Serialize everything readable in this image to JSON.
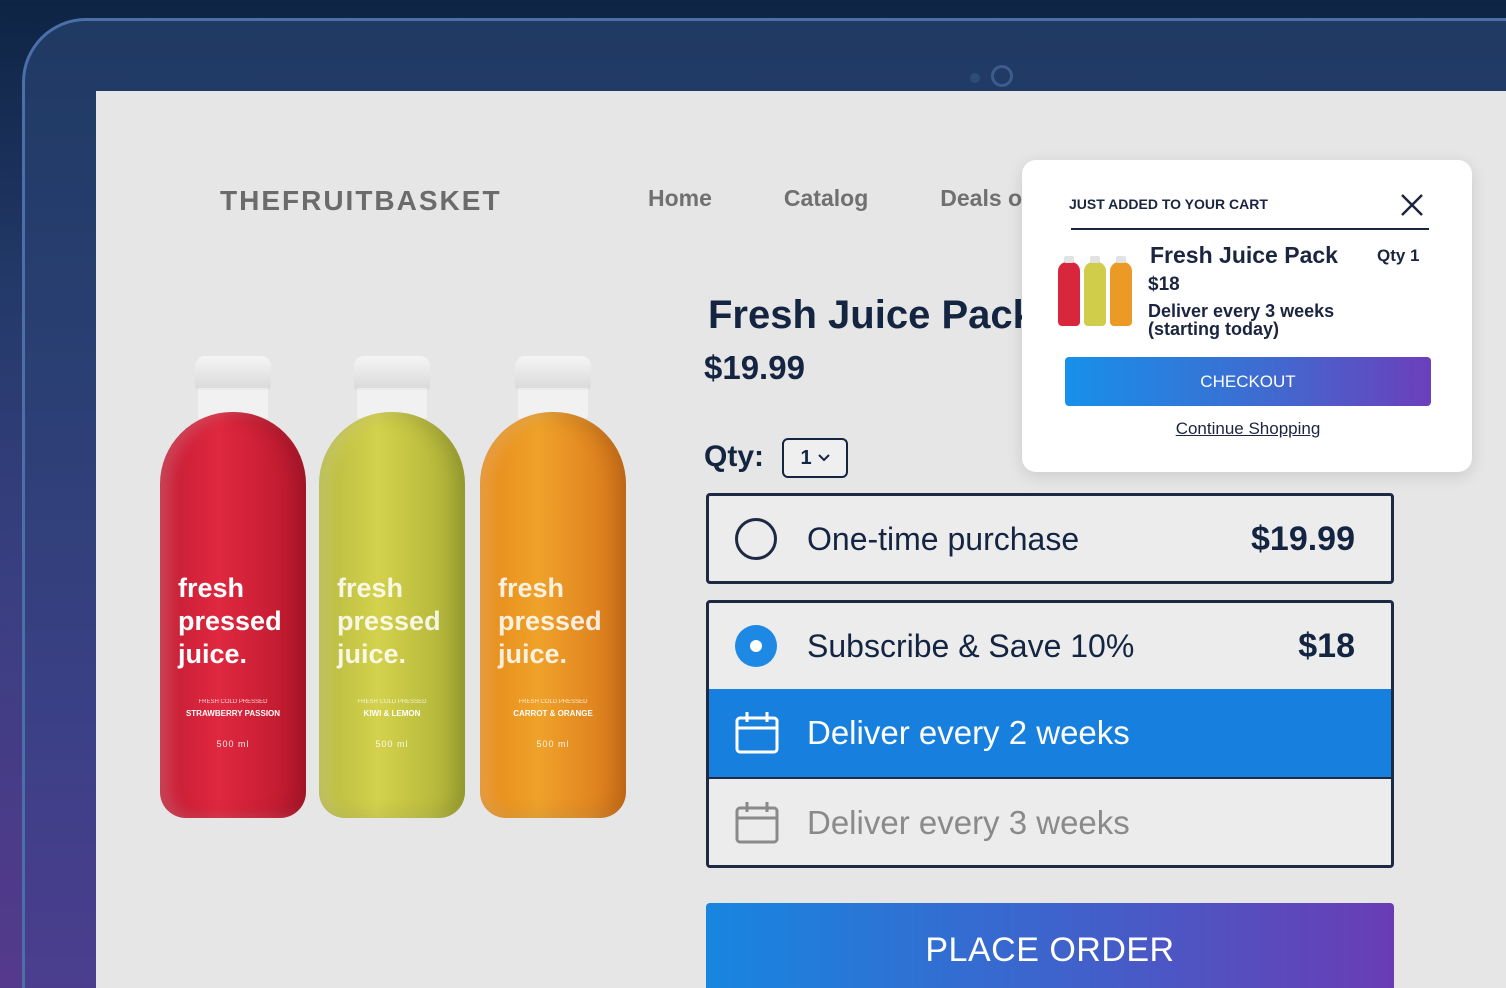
{
  "site": {
    "brand": "THEFRUITBASKET",
    "nav": [
      "Home",
      "Catalog",
      "Deals o"
    ]
  },
  "product": {
    "title": "Fresh Juice Pack",
    "price": "$19.99",
    "qty_label": "Qty:",
    "qty_value": "1",
    "bottles": [
      {
        "headline": "fresh pressed juice.",
        "subtitle": "FRESH COLD PRESSED",
        "flavor": "STRAWBERRY PASSION",
        "volume": "500 ml",
        "color": "#d8263c"
      },
      {
        "headline": "fresh pressed juice.",
        "subtitle": "FRESH COLD PRESSED",
        "flavor": "KIWI & LEMON",
        "volume": "500 ml",
        "color": "#cfcd4a"
      },
      {
        "headline": "fresh pressed juice.",
        "subtitle": "FRESH COLD PRESSED",
        "flavor": "CARROT & ORANGE",
        "volume": "500 ml",
        "color": "#eb9b25"
      }
    ]
  },
  "purchase_options": {
    "one_time": {
      "label": "One-time purchase",
      "price": "$19.99",
      "selected": false
    },
    "subscribe": {
      "label": "Subscribe & Save 10%",
      "price": "$18",
      "selected": true
    },
    "frequencies": [
      {
        "label": "Deliver every 2 weeks",
        "selected": true
      },
      {
        "label": "Deliver every 3 weeks",
        "selected": false
      }
    ]
  },
  "place_order_label": "PLACE ORDER",
  "cart_popup": {
    "heading": "JUST ADDED TO YOUR CART",
    "item_title": "Fresh Juice Pack",
    "item_qty": "Qty 1",
    "item_price": "$18",
    "item_delivery_line1": "Deliver every 3 weeks",
    "item_delivery_line2": "(starting today)",
    "checkout_label": "CHECKOUT",
    "continue_label": "Continue Shopping"
  },
  "colors": {
    "accent_blue": "#1780de",
    "accent_purple": "#6a3cb4",
    "text_dark": "#142542"
  }
}
